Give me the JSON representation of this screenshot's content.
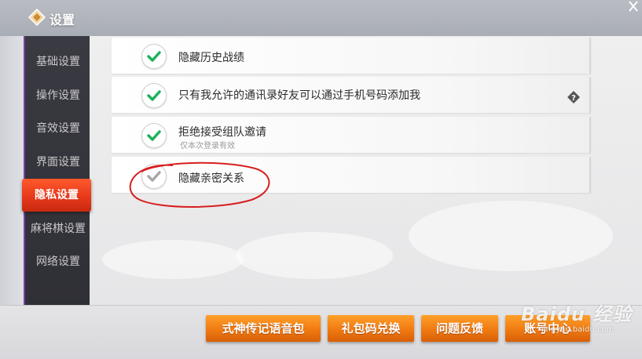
{
  "header": {
    "title": "设置"
  },
  "sidebar": {
    "items": [
      {
        "label": "基础设置",
        "active": false
      },
      {
        "label": "操作设置",
        "active": false
      },
      {
        "label": "音效设置",
        "active": false
      },
      {
        "label": "界面设置",
        "active": false
      },
      {
        "label": "隐私设置",
        "active": true
      },
      {
        "label": "麻将棋设置",
        "active": false
      },
      {
        "label": "网络设置",
        "active": false
      }
    ]
  },
  "privacy_options": [
    {
      "label": "隐藏历史战绩",
      "checked": true
    },
    {
      "label": "只有我允许的通讯录好友可以通过手机号码添加我",
      "checked": true,
      "has_help": true
    },
    {
      "label": "拒绝接受组队邀请",
      "sublabel": "仅本次登录有效",
      "checked": true
    },
    {
      "label": "隐藏亲密关系",
      "checked": false
    }
  ],
  "footer": {
    "buttons": [
      {
        "label": "式神传记语音包"
      },
      {
        "label": "礼包码兑换"
      },
      {
        "label": "问题反馈"
      },
      {
        "label": "账号中心"
      }
    ]
  },
  "watermark": {
    "brand": "Baidu 经验",
    "url": "jingyan.baidu.com"
  },
  "colors": {
    "accent_active": "#e6391b",
    "button_orange": "#f07a12",
    "check_green": "#1db35a",
    "annotation_red": "#d81e1e"
  },
  "icons": {
    "back": "diamond-back-icon",
    "check": "checkmark-icon",
    "help": "question-diamond-icon"
  }
}
